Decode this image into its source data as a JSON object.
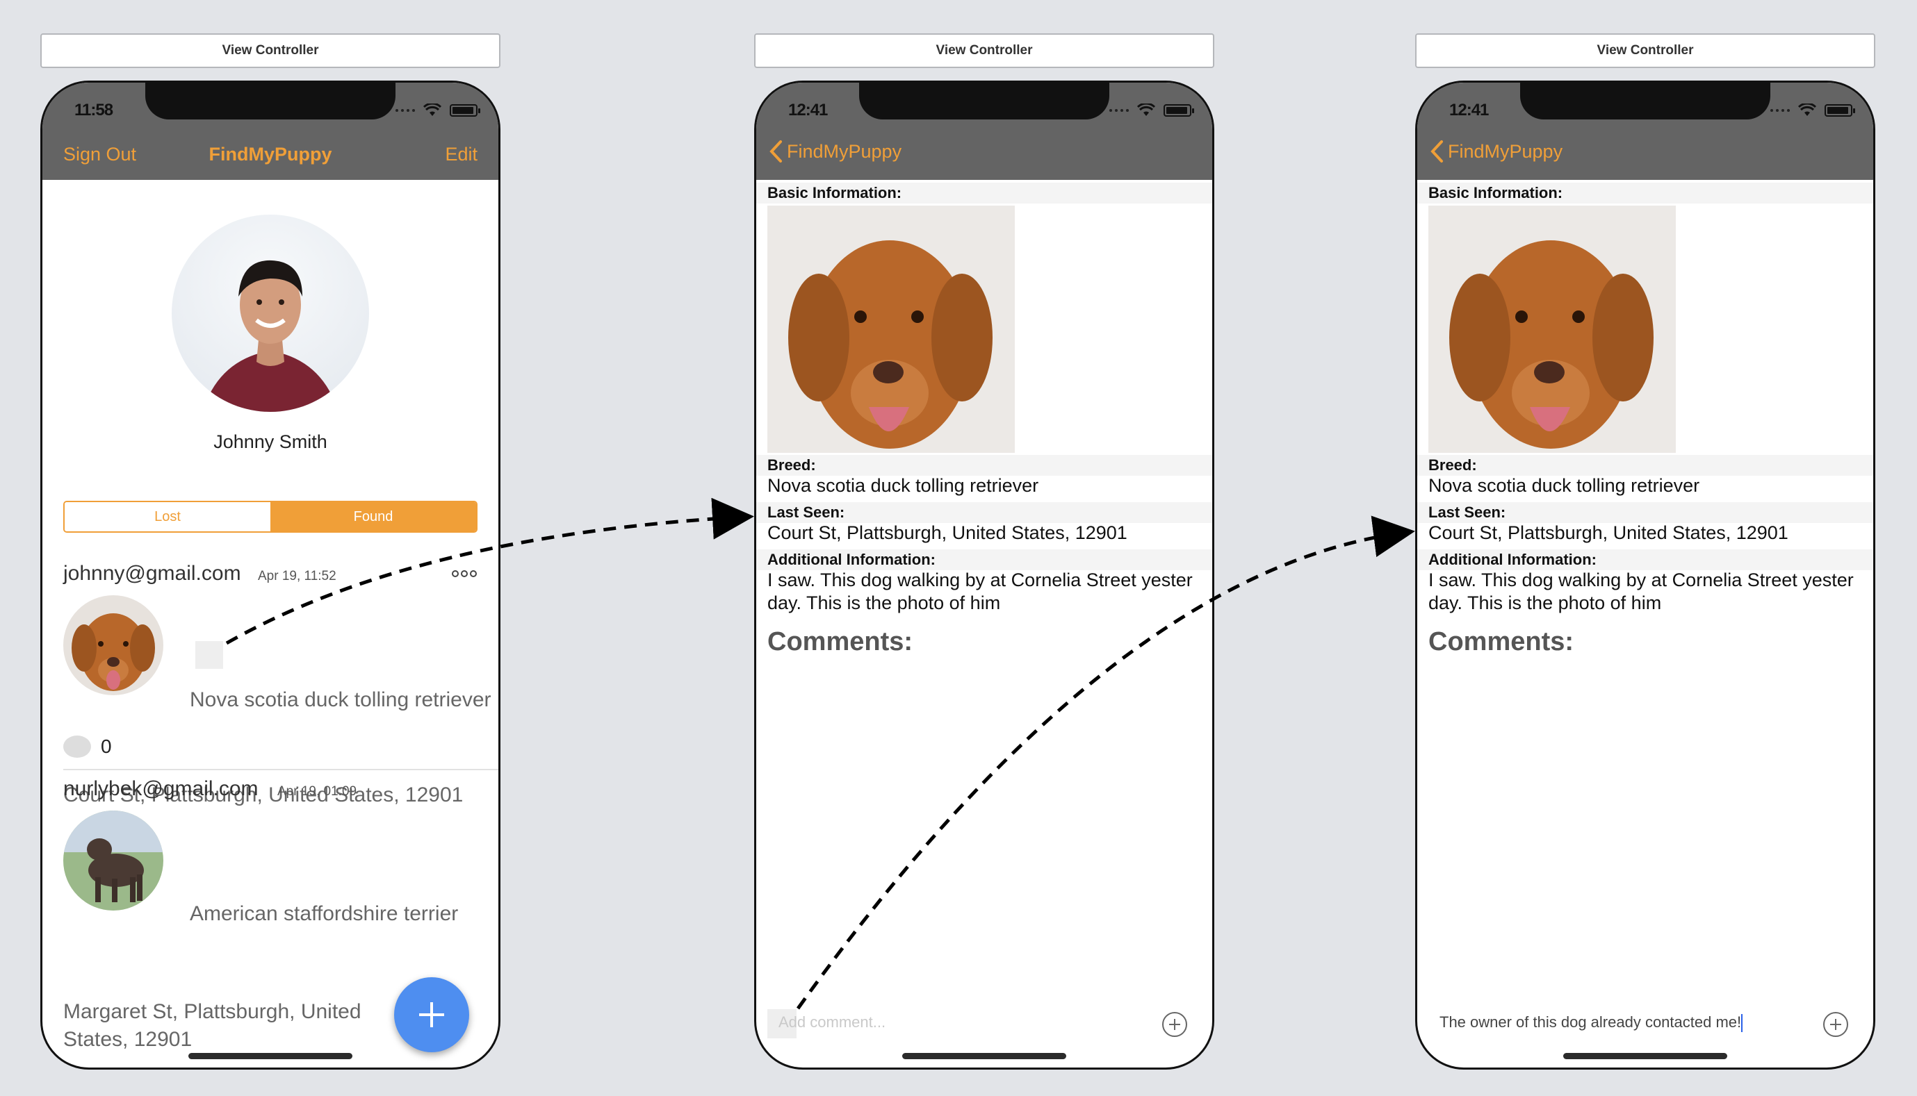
{
  "screens": [
    {
      "controller_label": "View Controller",
      "status_time": "11:58",
      "nav": {
        "left": "Sign Out",
        "title": "FindMyPuppy",
        "right": "Edit"
      },
      "profile_name": "Johnny Smith",
      "segments": {
        "lost": "Lost",
        "found": "Found",
        "selected": "Found"
      },
      "posts": [
        {
          "email": "johnny@gmail.com",
          "date": "Apr 19, 11:52",
          "breed": "Nova scotia duck tolling retriever",
          "address": "Court St, Plattsburgh, United States, 12901",
          "comment_count": "0"
        },
        {
          "email": "nurlybek@gmail.com",
          "date": "Apr 19, 01:09",
          "breed": "American staffordshire terrier",
          "address_line1": "Margaret St, Plattsburgh, United",
          "address_line2": "States, 12901"
        }
      ],
      "fab_icon": "plus-icon"
    },
    {
      "controller_label": "View Controller",
      "status_time": "12:41",
      "nav": {
        "back": "FindMyPuppy"
      },
      "basic_info_label": "Basic Information:",
      "breed_label": "Breed:",
      "breed": "Nova scotia duck tolling retriever",
      "last_seen_label": "Last Seen:",
      "last_seen": "Court St, Plattsburgh, United States, 12901",
      "additional_label": "Additional Information:",
      "additional": "I saw. This dog walking by at Cornelia Street yester day. This is the photo of him",
      "comments_label": "Comments:",
      "comment_placeholder": "Add comment..."
    },
    {
      "controller_label": "View Controller",
      "status_time": "12:41",
      "nav": {
        "back": "FindMyPuppy"
      },
      "basic_info_label": "Basic Information:",
      "breed_label": "Breed:",
      "breed": "Nova scotia duck tolling retriever",
      "last_seen_label": "Last Seen:",
      "last_seen": "Court St, Plattsburgh, United States, 12901",
      "additional_label": "Additional Information:",
      "additional": "I saw. This dog walking by at Cornelia Street yester day. This is the photo of him",
      "comments_label": "Comments:",
      "comment_text": "The owner of this dog already contacted me!"
    }
  ],
  "colors": {
    "accent": "#f09f38",
    "nav_bg": "#646464",
    "fab": "#4e8ef0",
    "canvas": "#e2e4e8"
  }
}
